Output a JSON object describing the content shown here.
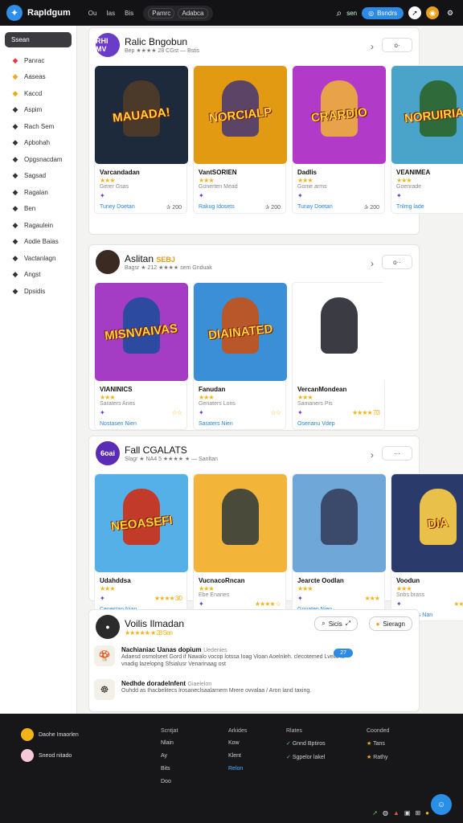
{
  "topbar": {
    "brand": "RapIdgum",
    "links": [
      "Ou",
      "Ias",
      "Bis"
    ],
    "search_chips": [
      "Pamrc",
      "Adabca"
    ],
    "label_right": "sen",
    "button": "Bsndrs",
    "logo_icon": "star-icon",
    "colors": {
      "accent": "#2d8be6",
      "bar": "#131316"
    }
  },
  "sidebar": {
    "header": "Ssean",
    "items": [
      {
        "icon": "target-icon",
        "label": "Panrac",
        "color": "#e63946"
      },
      {
        "icon": "flag-icon",
        "label": "Aaseas",
        "color": "#f2a71a"
      },
      {
        "icon": "grid-icon",
        "label": "Kaccd",
        "color": "#f2a71a"
      },
      {
        "icon": "circle-icon",
        "label": "Aspim",
        "color": "#333"
      },
      {
        "icon": "hand-icon",
        "label": "Rach Sem",
        "color": "#333"
      },
      {
        "icon": "person-icon",
        "label": "Apbohah",
        "color": "#333"
      },
      {
        "icon": "gear-icon",
        "label": "Opgsnacdam",
        "color": "#333"
      },
      {
        "icon": "bag-icon",
        "label": "Sagsad",
        "color": "#333"
      },
      {
        "icon": "page-icon",
        "label": "Ragalan",
        "color": "#333"
      },
      {
        "icon": "box-icon",
        "label": "Ben",
        "color": "#333"
      },
      {
        "icon": "archive-icon",
        "label": "Ragaulein",
        "color": "#333"
      },
      {
        "icon": "chart-icon",
        "label": "Aodie Baias",
        "color": "#333"
      },
      {
        "icon": "doc-icon",
        "label": "Vactanlagn",
        "color": "#333"
      },
      {
        "icon": "folder-icon",
        "label": "Angst",
        "color": "#333"
      },
      {
        "icon": "circle-icon",
        "label": "Dpsidis",
        "color": "#333"
      }
    ]
  },
  "cards": [
    {
      "title": "Ralic Bngobun",
      "subtitle": "Bep ★★★★ 28 CGst — Bstis",
      "avatar_text": "RHI MV",
      "avatar_color": "#6b3cc7",
      "menu": "o·",
      "tiles": [
        {
          "art_text": "MAUADA!",
          "bg": "#1c2a3b",
          "fig": "#4b3a2a",
          "name": "Varcandadan",
          "stars": "★★★",
          "meta": "Gerer Gsas",
          "foot_left": "Tuney Doetan",
          "foot_right": "✰ 200"
        },
        {
          "art_text": "NORCIALP",
          "bg": "#e29a12",
          "fig": "#5b4466",
          "name": "VantSORIEN",
          "stars": "★★★",
          "meta": "Gonerten Mead",
          "foot_left": "Rakug Idosets",
          "foot_right": "✰ 200"
        },
        {
          "art_text": "CRARDIO",
          "bg": "#b23ac9",
          "fig": "#e8a24a",
          "name": "Dadlis",
          "stars": "★★★",
          "meta": "Gome arms",
          "foot_left": "Tunay Doetan",
          "foot_right": "✰ 200"
        },
        {
          "art_text": "NORUIRIAN",
          "bg": "#4aa3c9",
          "fig": "#2f6a3a",
          "name": "VEANIMEA",
          "stars": "★★★",
          "meta": "Goenrade",
          "foot_left": "Tnlmg lade",
          "foot_right": ""
        }
      ]
    },
    {
      "title": "Aslitan",
      "badge": "SEBJ",
      "subtitle": "Bagsr ★ 212 ★★★★ sem Gnduak",
      "avatar_text": "",
      "avatar_color": "#3b2a22",
      "menu": "o··",
      "tiles": [
        {
          "art_text": "MISNVAIVAS",
          "bg": "#a43cc4",
          "fig": "#2b4aa0",
          "name": "VIANINICS",
          "stars": "★★★",
          "meta": "Saraters Anes",
          "foot_left": "Nostasen Nien",
          "foot_right": "",
          "stars2": "☆☆"
        },
        {
          "art_text": "DIAINATED",
          "bg": "#3a8fd6",
          "fig": "#b8572a",
          "name": "Fanudan",
          "stars": "★★★",
          "meta": "Genaters Lons",
          "foot_left": "Saraters Nien",
          "foot_right": "",
          "stars2": "☆☆"
        },
        {
          "art_text": "",
          "bg": "#ffffff",
          "fig": "#3b3b44",
          "name": "VercanMondean",
          "stars": "★★★",
          "meta": "Samaners Pis",
          "foot_left": "Oserianu Vdep",
          "foot_right": "",
          "stars2": "★★★★ 7/3"
        }
      ]
    },
    {
      "title": "Fall CGALATS",
      "subtitle": "Slagr ★ NA4 5 ★★★★ ★ — Sanltan",
      "avatar_text": "6oai",
      "avatar_color": "#5a2bb5",
      "menu": "···",
      "tiles": [
        {
          "art_text": "NEOASEFI",
          "bg": "#54b0e6",
          "fig": "#c23b2a",
          "name": "Udahddsa",
          "stars": "★★★",
          "meta": "",
          "foot_left": "Cenestan Nian",
          "foot_right": "",
          "stars2": "★★★★ 3/0"
        },
        {
          "art_text": "",
          "bg": "#f2b53a",
          "fig": "#4a4a3a",
          "name": "VucnacoRncan",
          "stars": "★★★",
          "meta": "Ebe Enanes",
          "foot_left": "Vaconaen Nian",
          "foot_right": "",
          "stars2": "★★★★ ☆"
        },
        {
          "art_text": "",
          "bg": "#6fa7d8",
          "fig": "#3b4a6b",
          "name": "Jearcte Oodlan",
          "stars": "★★★",
          "meta": "",
          "foot_left": "Gonaten Nien",
          "foot_right": "",
          "stars2": "★★★"
        },
        {
          "art_text": "DIA",
          "bg": "#2a3a6b",
          "fig": "#e8c04a",
          "name": "Voodun",
          "stars": "★★★",
          "meta": "Snbs brass",
          "foot_left": "Tengadas Nan",
          "foot_right": "",
          "stars2": "★★★★★"
        }
      ]
    }
  ],
  "card4": {
    "title": "Voilis Ilmadan",
    "subtitle": "★★★★★ ★ 28 Sen",
    "btn1": "Sicis",
    "btn2": "Sieragn",
    "rows": [
      {
        "icon": "mushroom-icon",
        "title": "Nachianiac Uanas dopium",
        "tag": "Uedenies",
        "body": "Adaesd osmolseet Gord if Nawalo vocop lotssa Ioag Vioan Aoelnleh. clecotemed Lvelic lo vnadig lazelopng Sfsialusr Venarinaag ost",
        "pill": "27"
      },
      {
        "icon": "robot-icon",
        "title": "Nedhde doradelnfent",
        "tag": "Giaelelon",
        "body": "Ouhdd as Ihacbelitecs lrosaneclsaalarnem Mrere ovvalaa / Aron land taxing.",
        "pill": ""
      }
    ]
  },
  "footer": {
    "badges": [
      "Daohe Imaorlen",
      "Sneod nitado"
    ],
    "cols": [
      {
        "head": "Scntjat",
        "items": [
          "Nlain",
          "Ay",
          "Bits",
          "Doo"
        ]
      },
      {
        "head": "Arkides",
        "items": [
          "Kow",
          "Klent",
          "Relon"
        ]
      },
      {
        "head": "Rlates",
        "items": [
          "Gnnd Bptiros",
          "Sgpelor lakel"
        ]
      },
      {
        "head": "Coonded",
        "items": [
          "Tans",
          "Rathy"
        ]
      }
    ]
  }
}
